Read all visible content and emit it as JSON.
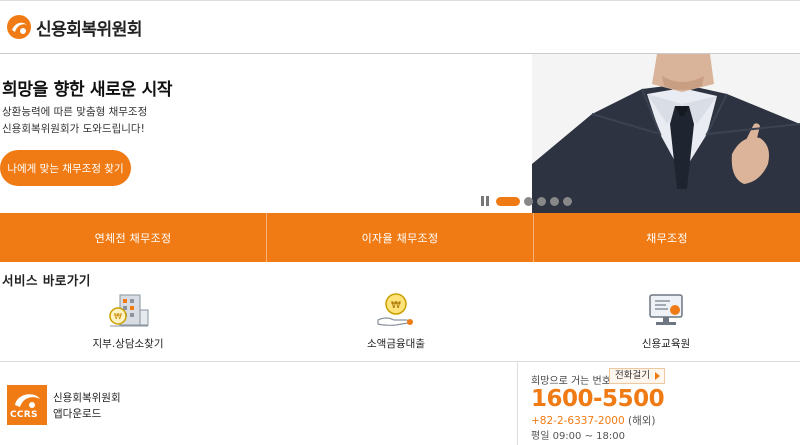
{
  "header": {
    "logo_text": "신용회복위원회",
    "logo_icon": "ccrs-swirl-icon"
  },
  "hero": {
    "title": "희망을 향한 새로운 시작",
    "sub_line1": "상환능력에 따른 맞춤형 채무조정",
    "sub_line2": "신용회복위원회가  도와드립니다!",
    "button_label": "나에게 맞는 채무조정 찾기",
    "carousel": {
      "slide_count": 5,
      "active_index": 0
    }
  },
  "tabs": [
    {
      "label": "연체전 채무조정"
    },
    {
      "label": "이자율 채무조정"
    },
    {
      "label": "채무조정"
    }
  ],
  "services": {
    "title": "서비스 바로가기",
    "items": [
      {
        "label": "지부.상담소찾기",
        "icon": "branch-finder-icon"
      },
      {
        "label": "소액금융대출",
        "icon": "microloan-icon"
      },
      {
        "label": "신용교육원",
        "icon": "education-icon"
      }
    ]
  },
  "app": {
    "badge": "CCRS",
    "name_line1": "신용회복위원회",
    "name_line2": "앱다운로드"
  },
  "call": {
    "label": "희망으로 거는 번호",
    "button": "전화걸기",
    "number": "1600-5500",
    "intl_number": "+82-2-6337-2000",
    "intl_note": "(해외)",
    "hours": "평일 09:00 ~ 18:00"
  },
  "colors": {
    "accent": "#f07b14",
    "tab_divider": "#f9b37a"
  }
}
